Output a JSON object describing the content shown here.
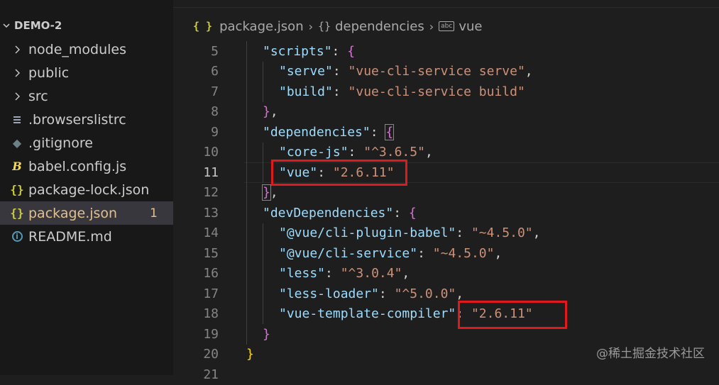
{
  "sidebar": {
    "project": "DEMO-2",
    "items": [
      {
        "label": "node_modules",
        "icon": "chevron-right-icon"
      },
      {
        "label": "public",
        "icon": "chevron-right-icon"
      },
      {
        "label": "src",
        "icon": "chevron-right-icon"
      },
      {
        "label": ".browserslistrc",
        "icon": "lines-file-icon"
      },
      {
        "label": ".gitignore",
        "icon": "git-diamond-icon"
      },
      {
        "label": "babel.config.js",
        "icon": "babel-icon"
      },
      {
        "label": "package-lock.json",
        "icon": "json-braces-icon"
      },
      {
        "label": "package.json",
        "icon": "json-braces-icon",
        "badge": "1",
        "active": true
      },
      {
        "label": "README.md",
        "icon": "info-icon"
      }
    ]
  },
  "breadcrumb": {
    "file": "package.json",
    "object": "dependencies",
    "key": "vue"
  },
  "code": {
    "lines": [
      {
        "n": "5"
      },
      {
        "n": "6"
      },
      {
        "n": "7"
      },
      {
        "n": "8"
      },
      {
        "n": "9"
      },
      {
        "n": "10"
      },
      {
        "n": "11"
      },
      {
        "n": "12"
      },
      {
        "n": "13"
      },
      {
        "n": "14"
      },
      {
        "n": "15"
      },
      {
        "n": "16"
      },
      {
        "n": "17"
      },
      {
        "n": "18"
      },
      {
        "n": "19"
      },
      {
        "n": "20"
      },
      {
        "n": "21"
      }
    ],
    "t": {
      "scripts": "\"scripts\"",
      "serve": "\"serve\"",
      "serve_v": "\"vue-cli-service serve\"",
      "build": "\"build\"",
      "build_v": "\"vue-cli-service build\"",
      "dependencies": "\"dependencies\"",
      "corejs": "\"core-js\"",
      "corejs_v": "\"^3.6.5\"",
      "vue": "\"vue\"",
      "vue_v": "\"2.6.11\"",
      "devdeps": "\"devDependencies\"",
      "babel": "\"@vue/cli-plugin-babel\"",
      "babel_v": "\"~4.5.0\"",
      "service": "\"@vue/cli-service\"",
      "service_v": "\"~4.5.0\"",
      "less": "\"less\"",
      "less_v": "\"^3.0.4\"",
      "lessloader": "\"less-loader\"",
      "lessloader_v": "\"^5.0.0\"",
      "vtc": "\"vue-template-compiler\"",
      "vtc_v": "\"2.6.11\""
    }
  },
  "colors": {
    "highlight_box": "#e0191d",
    "json_key": "#9cdcfe",
    "json_string": "#ce9178"
  },
  "watermark": "@稀土掘金技术社区"
}
